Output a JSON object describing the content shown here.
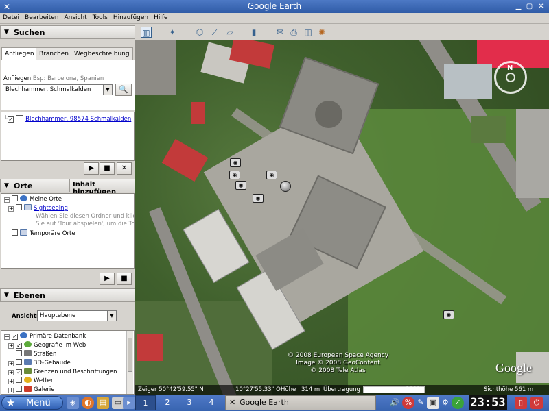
{
  "window": {
    "title": "Google Earth"
  },
  "menubar": [
    "Datei",
    "Bearbeiten",
    "Ansicht",
    "Tools",
    "Hinzufügen",
    "Hilfe"
  ],
  "search": {
    "header": "Suchen",
    "tabs": [
      "Anfliegen",
      "Branchen",
      "Wegbeschreibung"
    ],
    "fly_label": "Anfliegen",
    "fly_hint": "Bsp: Barcelona, Spanien",
    "fly_value": "Blechhammer, Schmalkalden",
    "result": "Blechhammer, 98574 Schmalkalden"
  },
  "places": {
    "header": "Orte",
    "add_button": "Inhalt hinzufügen",
    "items": [
      {
        "label": "Meine Orte"
      },
      {
        "label": "Sightseeing"
      },
      {
        "label": "Wählen Sie diesen Ordner und klicken"
      },
      {
        "label": "Sie auf 'Tour abspielen', um die Tour zu"
      },
      {
        "label": "Temporäre Orte"
      }
    ]
  },
  "layers": {
    "header": "Ebenen",
    "view_label": "Ansicht:",
    "view_value": "Hauptebene",
    "items": [
      {
        "label": "Primäre Datenbank"
      },
      {
        "label": "Geografie im Web"
      },
      {
        "label": "Straßen"
      },
      {
        "label": "3D-Gebäude"
      },
      {
        "label": "Grenzen und Beschriftungen"
      },
      {
        "label": "Wetter"
      },
      {
        "label": "Galerie"
      }
    ]
  },
  "map": {
    "copyright": [
      "© 2008 European Space Agency",
      "Image © 2008 GeoContent",
      "© 2008 Tele Atlas"
    ],
    "logo": "Google",
    "compass_n": "N",
    "status": {
      "pointer": "Zeiger 50°42'59.55\" N",
      "lon": "10°27'55.33\" O",
      "alt_label": "Höhe",
      "alt_value": "314 m",
      "transfer_label": "Übertragung",
      "transfer_value": "100%",
      "view_label": "Sichthöhe",
      "view_value": "561 m"
    }
  },
  "taskbar": {
    "menu": "Menü",
    "desktops": [
      "1",
      "2",
      "3",
      "4"
    ],
    "task": "Google Earth",
    "clock": "23:53"
  }
}
